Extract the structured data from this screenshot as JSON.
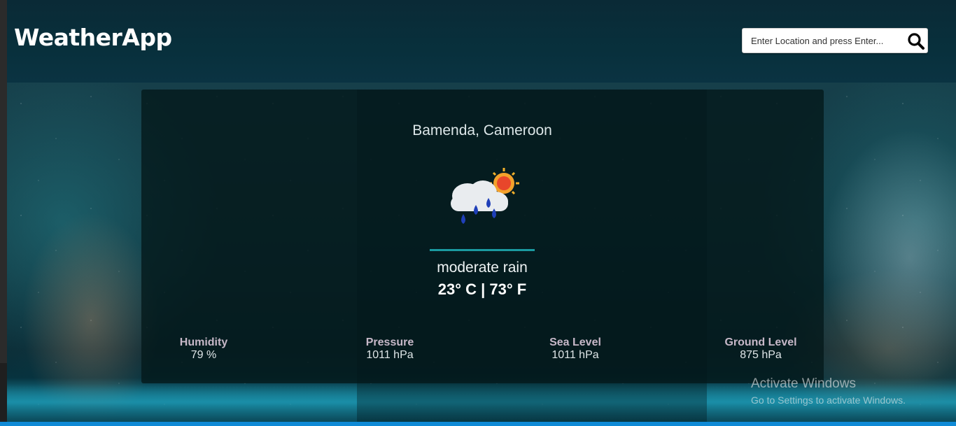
{
  "header": {
    "logo": "WeatherApp",
    "search_placeholder": "Enter Location and press Enter..."
  },
  "weather": {
    "location": "Bamenda, Cameroon",
    "icon": "rain-cloud-sun-icon",
    "description": "moderate rain",
    "temperature": "23° C | 73° F"
  },
  "stats": [
    {
      "label": "Humidity",
      "value": "79 %"
    },
    {
      "label": "Pressure",
      "value": "1011 hPa"
    },
    {
      "label": "Sea Level",
      "value": "1011 hPa"
    },
    {
      "label": "Ground Level",
      "value": "875 hPa"
    }
  ],
  "windows_watermark": {
    "title": "Activate Windows",
    "subtitle": "Go to Settings to activate Windows."
  },
  "colors": {
    "header_bg": "#08303c",
    "accent": "#1a9aa0",
    "card_bg": "#04181a"
  }
}
